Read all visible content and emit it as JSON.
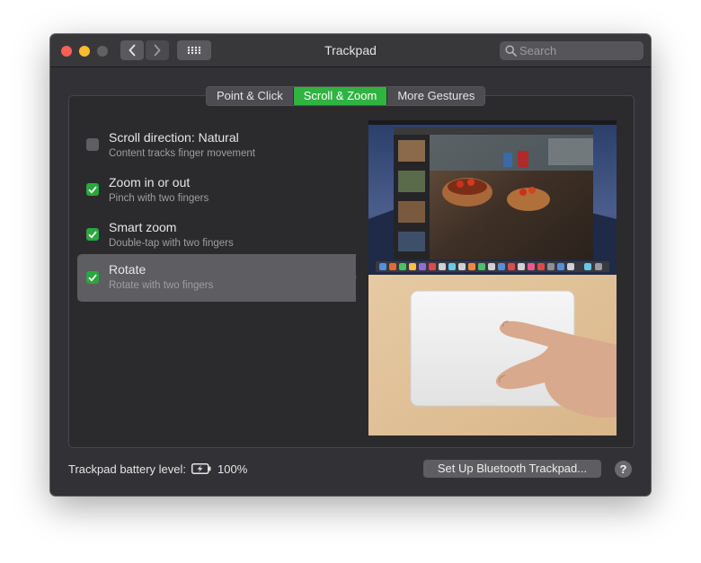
{
  "window": {
    "title": "Trackpad"
  },
  "toolbar": {
    "back_icon": "chevron-left-icon",
    "forward_icon": "chevron-right-icon",
    "show_all_icon": "grid-icon",
    "search_placeholder": "Search",
    "search_value": ""
  },
  "tabs": [
    {
      "label": "Point & Click",
      "active": false
    },
    {
      "label": "Scroll & Zoom",
      "active": true
    },
    {
      "label": "More Gestures",
      "active": false
    }
  ],
  "options": [
    {
      "title": "Scroll direction: Natural",
      "subtitle": "Content tracks finger movement",
      "checked": false,
      "selected": false
    },
    {
      "title": "Zoom in or out",
      "subtitle": "Pinch with two fingers",
      "checked": true,
      "selected": false
    },
    {
      "title": "Smart zoom",
      "subtitle": "Double-tap with two fingers",
      "checked": true,
      "selected": false
    },
    {
      "title": "Rotate",
      "subtitle": "Rotate with two fingers",
      "checked": true,
      "selected": true
    }
  ],
  "footer": {
    "battery_label": "Trackpad battery level:",
    "battery_icon": "battery-charging-icon",
    "battery_value": "100%",
    "setup_button": "Set Up Bluetooth Trackpad...",
    "help_button": "?"
  },
  "colors": {
    "accent": "#2fb341",
    "checkbox_checked": "#29a83c",
    "window_bg": "#323236"
  }
}
